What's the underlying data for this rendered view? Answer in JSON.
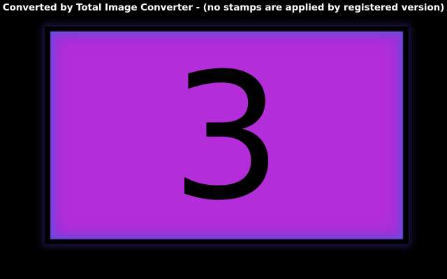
{
  "watermark": {
    "text": "Converted by Total Image Converter - (no stamps are applied by registered version)"
  },
  "card": {
    "number": "3",
    "fill_color": "#b32dd8",
    "edge_color": "#6450dc",
    "digit_color": "#000000"
  },
  "background_color": "#000000"
}
